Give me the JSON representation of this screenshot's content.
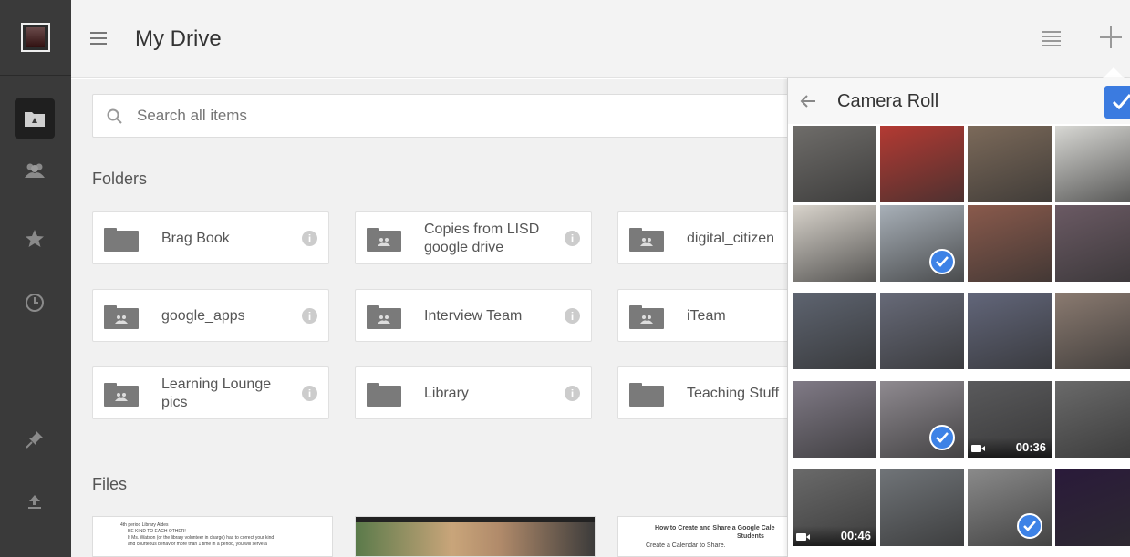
{
  "header": {
    "title": "My Drive"
  },
  "search": {
    "placeholder": "Search all items"
  },
  "sections": {
    "folders": "Folders",
    "files": "Files"
  },
  "folders": [
    {
      "label": "Brag Book",
      "shared": false
    },
    {
      "label": "Copies from LISD google drive",
      "shared": true
    },
    {
      "label": "digital_citizen",
      "shared": true
    },
    {
      "label": "google_apps",
      "shared": true
    },
    {
      "label": "Interview Team",
      "shared": true
    },
    {
      "label": "iTeam",
      "shared": true
    },
    {
      "label": "Learning Lounge pics",
      "shared": true
    },
    {
      "label": "Library",
      "shared": false
    },
    {
      "label": "Teaching Stuff",
      "shared": false
    }
  ],
  "files": [
    {
      "lines": [
        "4th period Library Aides",
        "BE KIND TO EACH OTHER!",
        "If Ms. Watson (or the library volunteer in charge) has to correct your kind",
        "and courteous behavior more than 1 time in a period, you will serve a"
      ]
    },
    {
      "lines": []
    },
    {
      "lines": [
        "How to Create and Share a Google Cale",
        "Students",
        "Create a Calendar to Share."
      ]
    }
  ],
  "camera_roll": {
    "title": "Camera Roll",
    "thumbs": [
      {
        "selected": false,
        "duration": null,
        "color": "#6f6d6a"
      },
      {
        "selected": false,
        "duration": null,
        "color": "#b43a33"
      },
      {
        "selected": false,
        "duration": null,
        "color": "#7c6a5a"
      },
      {
        "selected": false,
        "duration": null,
        "color": "#d8d8d4"
      },
      {
        "selected": false,
        "duration": null,
        "color": "#d9d4cc"
      },
      {
        "selected": true,
        "duration": null,
        "color": "#a8b0b8"
      },
      {
        "selected": false,
        "duration": null,
        "color": "#8a5a4c"
      },
      {
        "selected": false,
        "duration": null,
        "color": "#6b5a64"
      },
      {
        "selected": false,
        "duration": null,
        "color": "#5e6470"
      },
      {
        "selected": false,
        "duration": null,
        "color": "#676a78"
      },
      {
        "selected": false,
        "duration": null,
        "color": "#62667a"
      },
      {
        "selected": false,
        "duration": null,
        "color": "#8a7a70"
      },
      {
        "selected": false,
        "duration": null,
        "color": "#807a86"
      },
      {
        "selected": true,
        "duration": null,
        "color": "#8f8a90"
      },
      {
        "selected": false,
        "duration": "00:36",
        "color": "#5a5a5c"
      },
      {
        "selected": false,
        "duration": null,
        "color": "#6a6a6a"
      },
      {
        "selected": false,
        "duration": "00:46",
        "color": "#6a6a6a"
      },
      {
        "selected": false,
        "duration": null,
        "color": "#707478"
      },
      {
        "selected": true,
        "duration": null,
        "color": "#8a8a8a"
      },
      {
        "selected": false,
        "duration": null,
        "color": "#2a1a3a"
      }
    ]
  },
  "colors": {
    "accent": "#3b7be0"
  }
}
